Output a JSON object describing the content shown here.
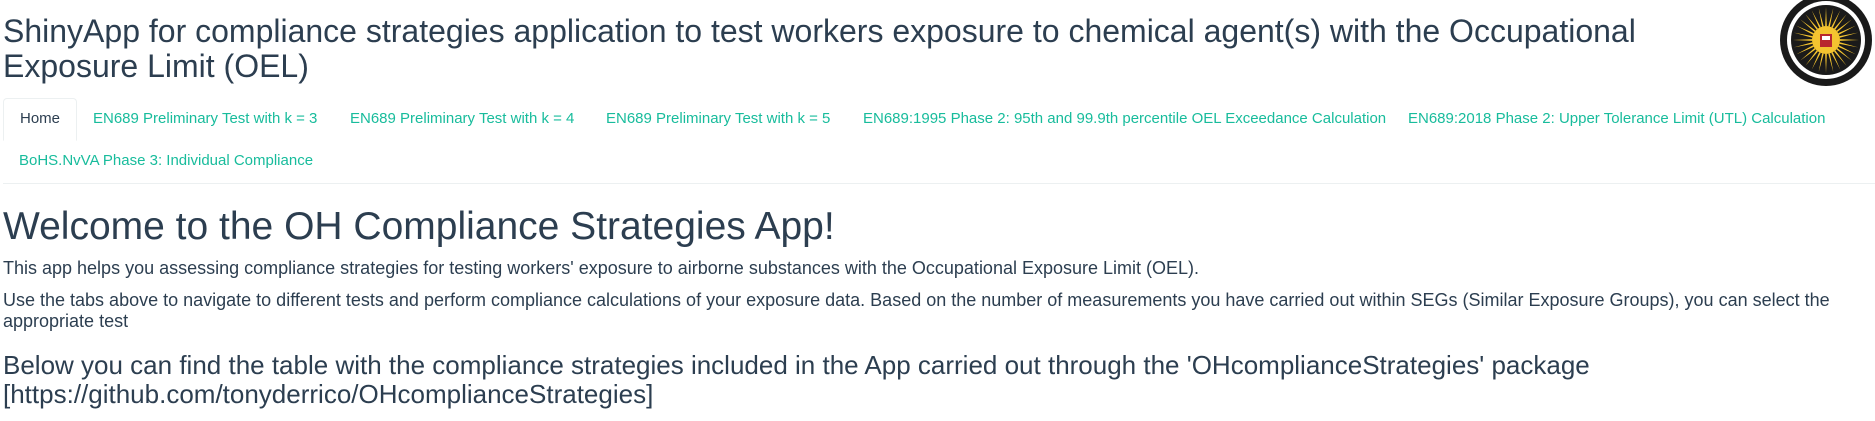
{
  "header": {
    "title": "ShinyApp for compliance strategies application to test workers exposure to chemical agent(s) with the Occupational Exposure Limit (OEL)",
    "logo_icon": "university-sun-seal-icon"
  },
  "tabs": [
    {
      "label": "Home",
      "active": true
    },
    {
      "label": "EN689 Preliminary Test with k = 3",
      "active": false
    },
    {
      "label": "EN689 Preliminary Test with k = 4",
      "active": false
    },
    {
      "label": "EN689 Preliminary Test with k = 5",
      "active": false
    },
    {
      "label": "EN689:1995 Phase 2: 95th and 99.9th percentile OEL Exceedance Calculation",
      "active": false
    },
    {
      "label": "EN689:2018 Phase 2: Upper Tolerance Limit (UTL) Calculation",
      "active": false
    },
    {
      "label": "BoHS.NvVA Phase 3: Individual Compliance",
      "active": false
    }
  ],
  "main": {
    "welcome_heading": "Welcome to the OH Compliance Strategies App!",
    "intro": "This app helps you assessing compliance strategies for testing workers' exposure to airborne substances with the Occupational Exposure Limit (OEL).",
    "instructions": "Use the tabs above to navigate to different tests and perform compliance calculations of your exposure data. Based on the number of measurements you have carried out within SEGs (Similar Exposure Groups), you can select the appropriate test",
    "table_heading": "Below you can find the table with the compliance strategies included in the App carried out through the 'OHcomplianceStrategies' package [https://github.com/tonyderrico/OHcomplianceStrategies]"
  },
  "colors": {
    "text": "#2c3e50",
    "link": "#18bc9c",
    "logo_red": "#b8282e",
    "logo_gold": "#f4c430"
  }
}
